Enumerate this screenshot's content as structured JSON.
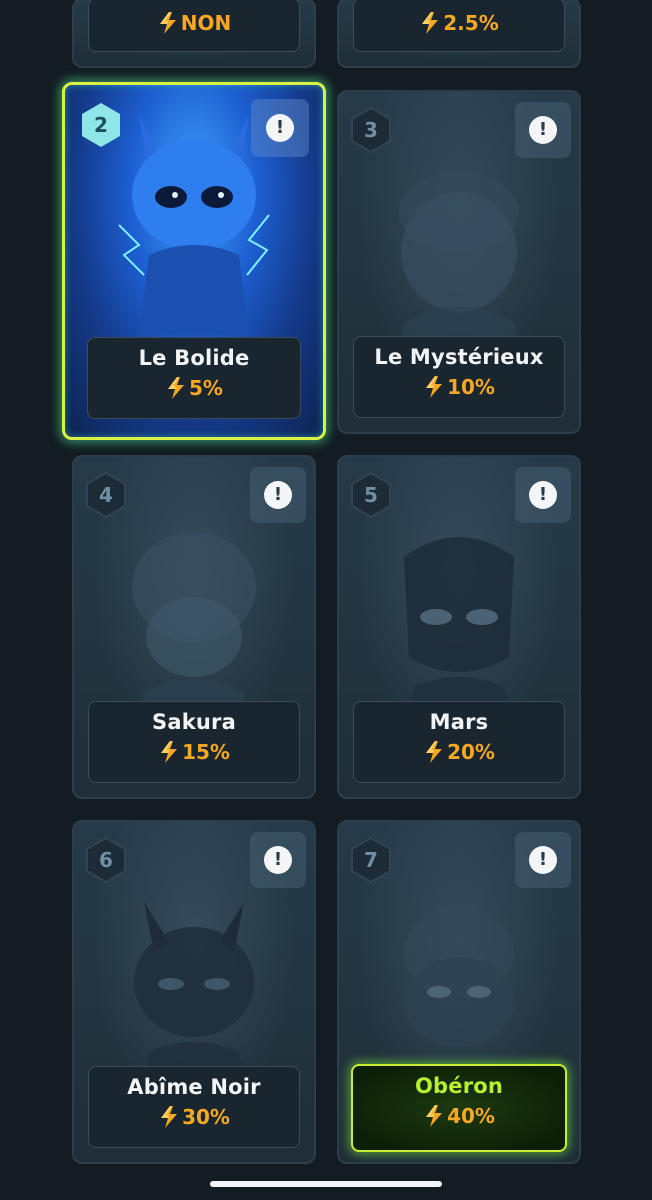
{
  "colors": {
    "background": "#121c22",
    "percent": "#f7a823",
    "active_border": "#d9f244",
    "special_name": "#b7f032"
  },
  "icons": {
    "info": "exclamation-circle-icon",
    "percent": "lightning-bolt-icon",
    "level": "hexagon-badge-icon"
  },
  "top_cards": [
    {
      "percent": "NON"
    },
    {
      "percent": "2.5%"
    }
  ],
  "cards": [
    {
      "level": "2",
      "name": "Le Bolide",
      "percent": "5%",
      "state": "active"
    },
    {
      "level": "3",
      "name": "Le Mystérieux",
      "percent": "10%",
      "state": "locked"
    },
    {
      "level": "4",
      "name": "Sakura",
      "percent": "15%",
      "state": "locked"
    },
    {
      "level": "5",
      "name": "Mars",
      "percent": "20%",
      "state": "locked"
    },
    {
      "level": "6",
      "name": "Abîme Noir",
      "percent": "30%",
      "state": "locked"
    },
    {
      "level": "7",
      "name": "Obéron",
      "percent": "40%",
      "state": "locked-special"
    }
  ],
  "info_symbol": "!"
}
